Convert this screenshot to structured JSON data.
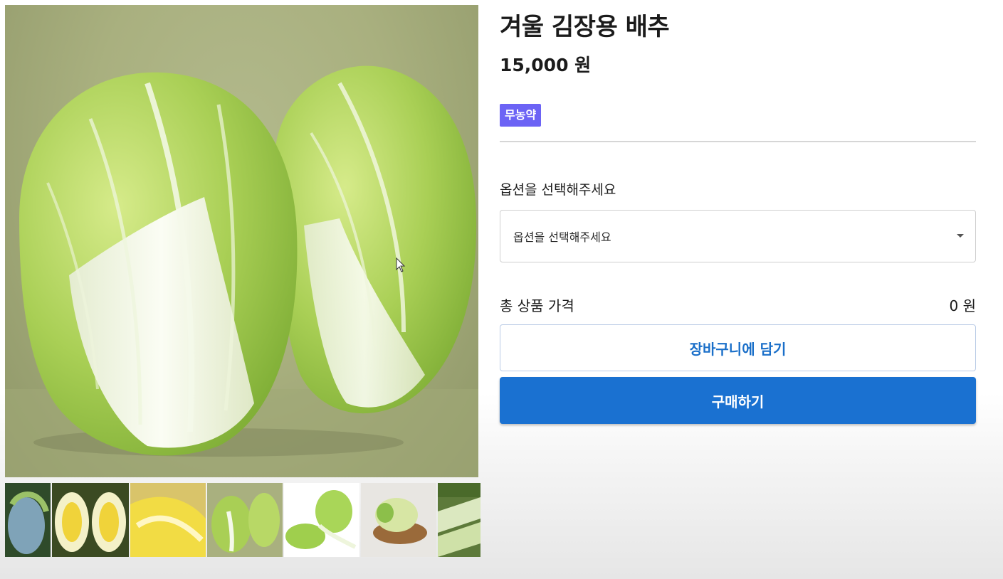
{
  "product": {
    "title": "겨울 김장용 배추",
    "price": "15,000 원",
    "badge": "무농약",
    "main_image": "napa-cabbage-pair-photo"
  },
  "options": {
    "label": "옵션을 선택해주세요",
    "selected": "옵션을 선택해주세요"
  },
  "total": {
    "label": "총 상품 가격",
    "value": "0 원"
  },
  "buttons": {
    "cart": "장바구니에 담기",
    "buy": "구매하기"
  },
  "thumbnails": [
    "cabbage-field-photo",
    "halved-cabbage-photo",
    "cabbage-cross-section-photo",
    "cabbage-pair-photo",
    "cabbage-leaves-photo",
    "cabbage-basket-photo",
    "cabbage-stack-photo"
  ],
  "colors": {
    "badge": "#6c63f5",
    "buy_button": "#1a71d1",
    "cart_text": "#1a6fc9"
  }
}
